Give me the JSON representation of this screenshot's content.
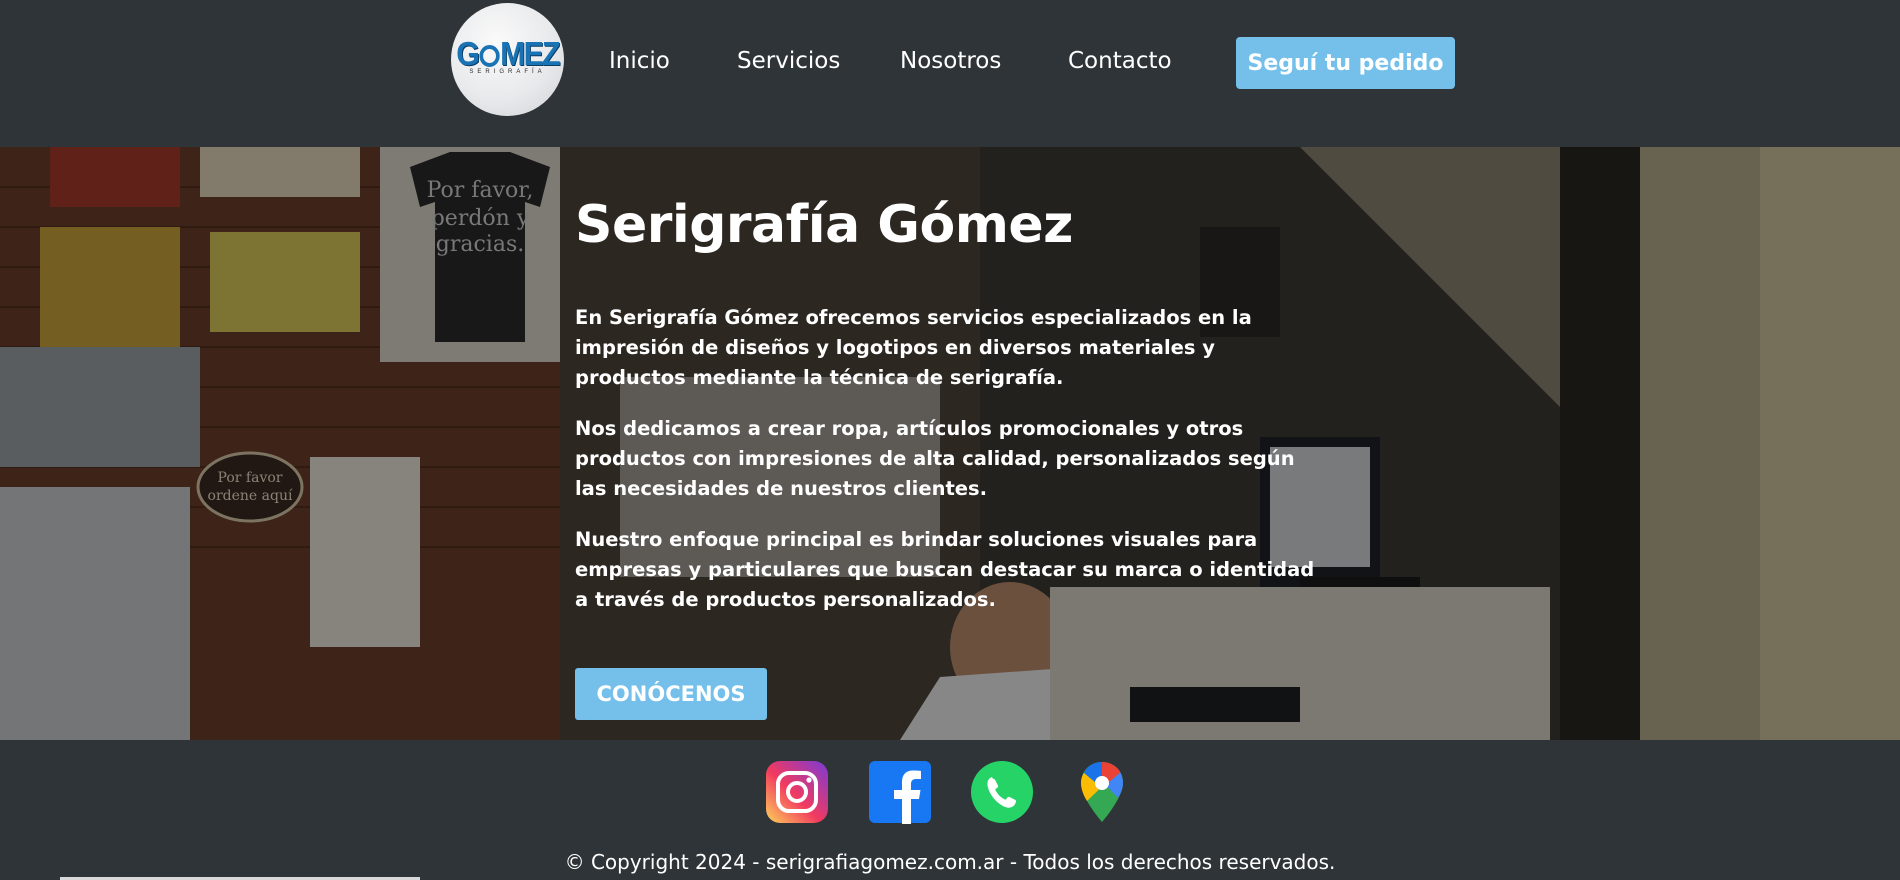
{
  "header": {
    "logo": {
      "text_part1": "G",
      "text_part2": "MEZ",
      "subtitle": "SERIGRAFÍA",
      "icon": "logo"
    },
    "nav": [
      {
        "label": "Inicio"
      },
      {
        "label": "Servicios"
      },
      {
        "label": "Nosotros"
      },
      {
        "label": "Contacto"
      }
    ],
    "cta_label": "Seguí tu pedido",
    "accent_color": "#74c0ea"
  },
  "hero": {
    "title": "Serigrafía Gómez",
    "paragraphs": [
      "En Serigrafía Gómez ofrecemos servicios especializados en la impresión de diseños y logotipos en diversos materiales y productos mediante la técnica de serigrafía.",
      "Nos dedicamos a crear ropa, artículos promocionales y otros productos con impresiones de alta calidad, personalizados según las necesidades de nuestros clientes.",
      "Nuestro enfoque principal es brindar soluciones visuales para empresas y particulares que buscan destacar su marca o identidad a través de productos personalizados."
    ],
    "button_label": "CONÓCENOS",
    "background_image": "print-shop-photo"
  },
  "footer": {
    "social": [
      {
        "icon": "instagram-icon"
      },
      {
        "icon": "facebook-icon"
      },
      {
        "icon": "whatsapp-icon"
      },
      {
        "icon": "google-maps-icon"
      }
    ],
    "copyright": "© Copyright 2024 - serigrafiagomez.com.ar - Todos los derechos reservados.",
    "background_color": "#2f3438"
  }
}
